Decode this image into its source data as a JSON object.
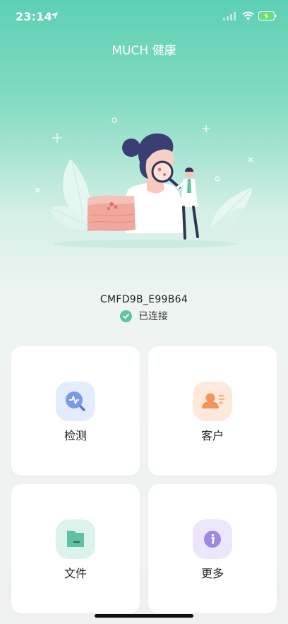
{
  "status": {
    "time": "23:14",
    "icons": [
      "location-arrow-icon",
      "signal-icon",
      "wifi-icon",
      "battery-charging-icon"
    ]
  },
  "header": {
    "title": "MUCH 健康"
  },
  "device": {
    "id": "CMFD9B_E99B64",
    "status": "已连接",
    "status_color": "#5cc3a5"
  },
  "menu": [
    {
      "label": "检测",
      "icon": "detect-icon",
      "color": "#6b8fe6"
    },
    {
      "label": "客户",
      "icon": "customer-icon",
      "color": "#f0a06a"
    },
    {
      "label": "文件",
      "icon": "file-icon",
      "color": "#5fc2a5"
    },
    {
      "label": "更多",
      "icon": "more-info-icon",
      "color": "#9b8be0"
    }
  ],
  "colors": {
    "accent": "#5cd0b3",
    "background": "#eef1f0"
  }
}
